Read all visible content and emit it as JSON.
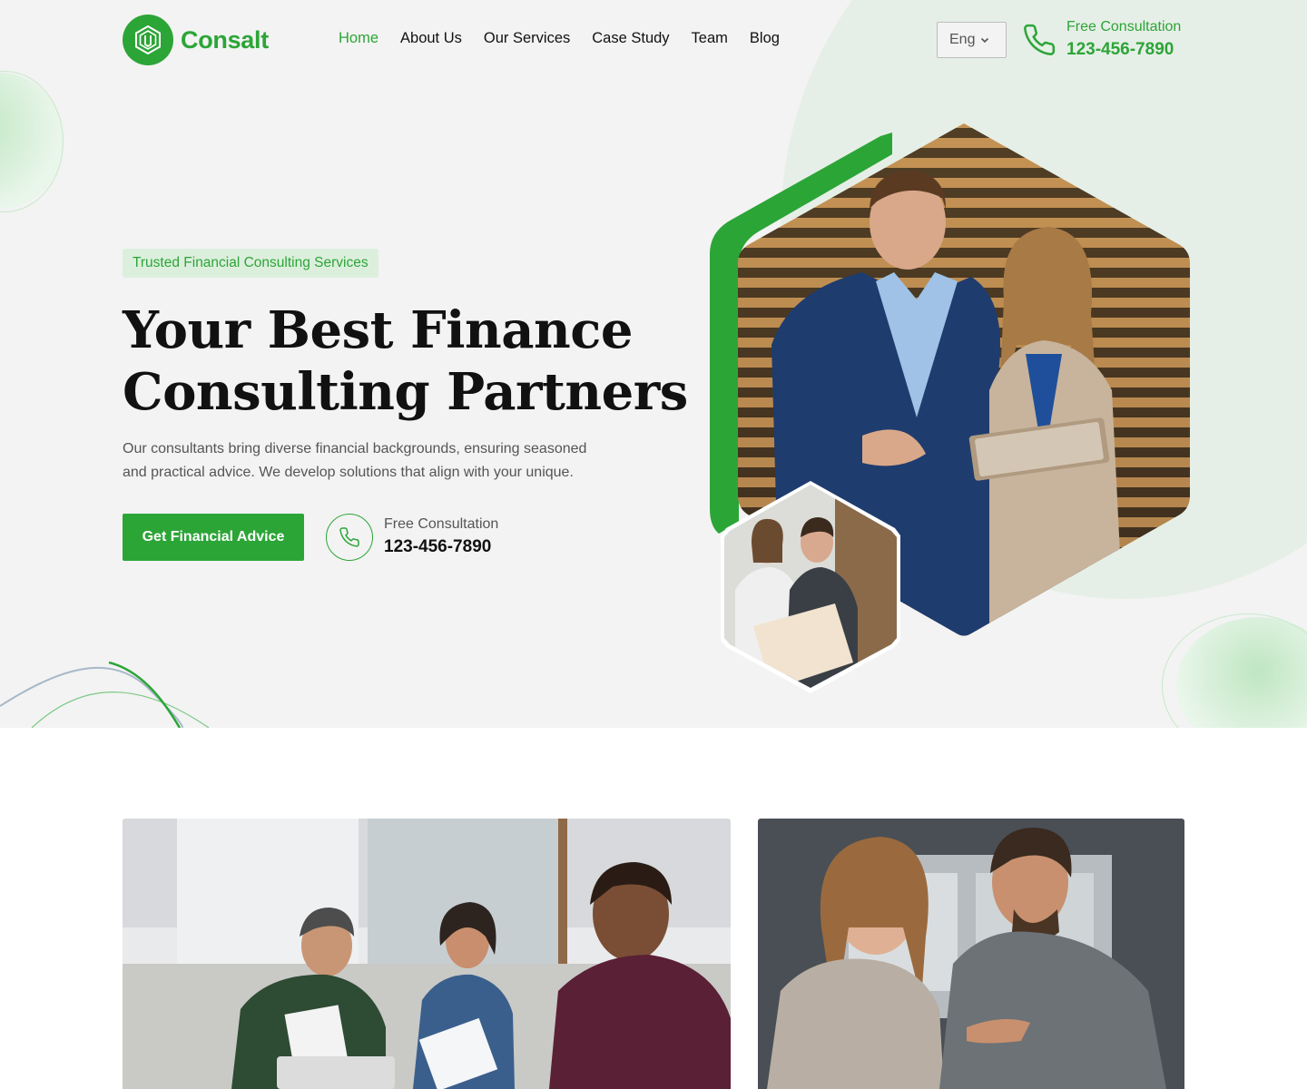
{
  "brand": {
    "name": "Consalt",
    "color": "#2ca537",
    "logo_icon": "hexagon-logo-icon"
  },
  "nav": {
    "items": [
      {
        "label": "Home",
        "active": true
      },
      {
        "label": "About Us",
        "active": false
      },
      {
        "label": "Our Services",
        "active": false
      },
      {
        "label": "Case Study",
        "active": false
      },
      {
        "label": "Team",
        "active": false
      },
      {
        "label": "Blog",
        "active": false
      }
    ]
  },
  "language": {
    "selected": "Eng",
    "icon": "chevron-down-icon"
  },
  "header_cta": {
    "label": "Free Consultation",
    "number": "123-456-7890",
    "icon": "phone-icon"
  },
  "hero": {
    "badge": "Trusted Financial Consulting Services",
    "title_line1": "Your Best Finance",
    "title_line2": "Consulting Partners",
    "description": "Our consultants bring diverse financial backgrounds, ensuring seasoned and practical advice. We develop solutions that align with your unique.",
    "primary_button": "Get Financial Advice",
    "call_label": "Free Consultation",
    "call_number": "123-456-7890"
  },
  "colors": {
    "accent": "#2ca537",
    "hero_bg": "#f3f3f3",
    "badge_bg": "#dcefdd"
  }
}
